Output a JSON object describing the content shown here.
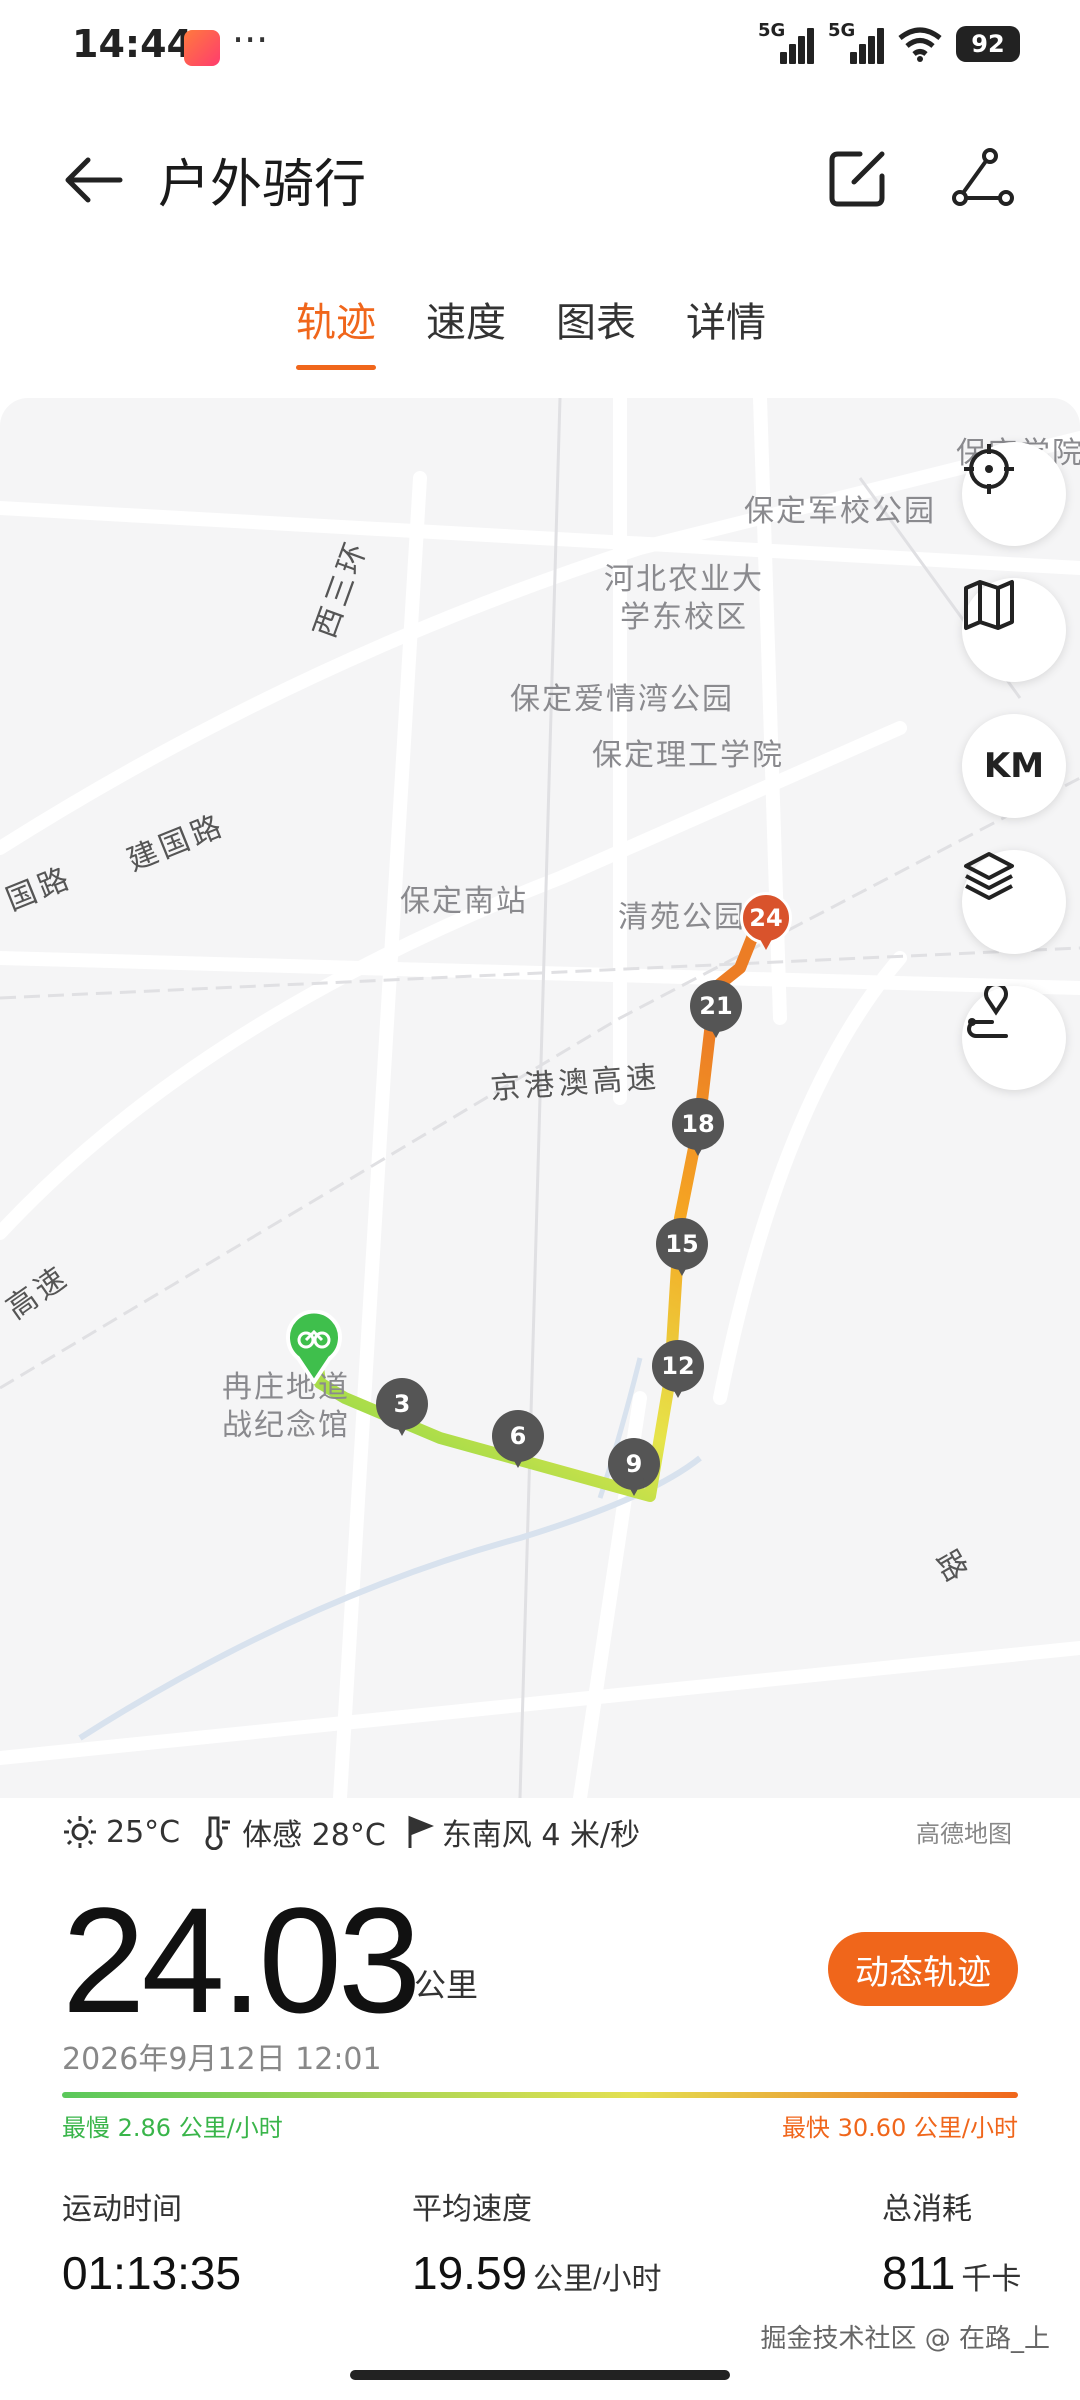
{
  "status": {
    "time": "14:44",
    "dots": "···",
    "sig1": "5G",
    "sig2": "5G",
    "battery": "92"
  },
  "header": {
    "title": "户外骑行"
  },
  "tabs": [
    {
      "label": "轨迹",
      "active": true
    },
    {
      "label": "速度",
      "active": false
    },
    {
      "label": "图表",
      "active": false
    },
    {
      "label": "详情",
      "active": false
    }
  ],
  "map": {
    "places": [
      "保定学院",
      "保定军校公园",
      "河北农业大",
      "学东校区",
      "保定爱情湾公园",
      "保定理工学院",
      "保定南站",
      "清苑公园",
      "冉庄地道",
      "战纪念馆"
    ],
    "roads": [
      "西三环",
      "建国路",
      "国路",
      "京港澳高速",
      "高速",
      "路",
      "速"
    ],
    "controls": {
      "km": "KM"
    },
    "markers": [
      "3",
      "6",
      "9",
      "12",
      "15",
      "18",
      "21",
      "24"
    ],
    "credit": "高德地图"
  },
  "weather": {
    "temp": "25°C",
    "feels": "体感 28°C",
    "wind": "东南风 4 米/秒"
  },
  "summary": {
    "distance": "24.03",
    "distance_unit": "公里",
    "dynamic_label": "动态轨迹",
    "datetime": "2026年9月12日 12:01",
    "slowest": "最慢 2.86 公里/小时",
    "fastest": "最快 30.60 公里/小时"
  },
  "stats": [
    {
      "label": "运动时间",
      "value": "01:13:35",
      "unit": ""
    },
    {
      "label": "平均速度",
      "value": "19.59",
      "unit": "公里/小时"
    },
    {
      "label": "总消耗",
      "value": "811",
      "unit": "千卡"
    }
  ],
  "watermark": "掘金技术社区 @ 在路_上",
  "colors": {
    "accent": "#f0661b",
    "slow": "#39b54a",
    "mid": "#e4e051"
  }
}
